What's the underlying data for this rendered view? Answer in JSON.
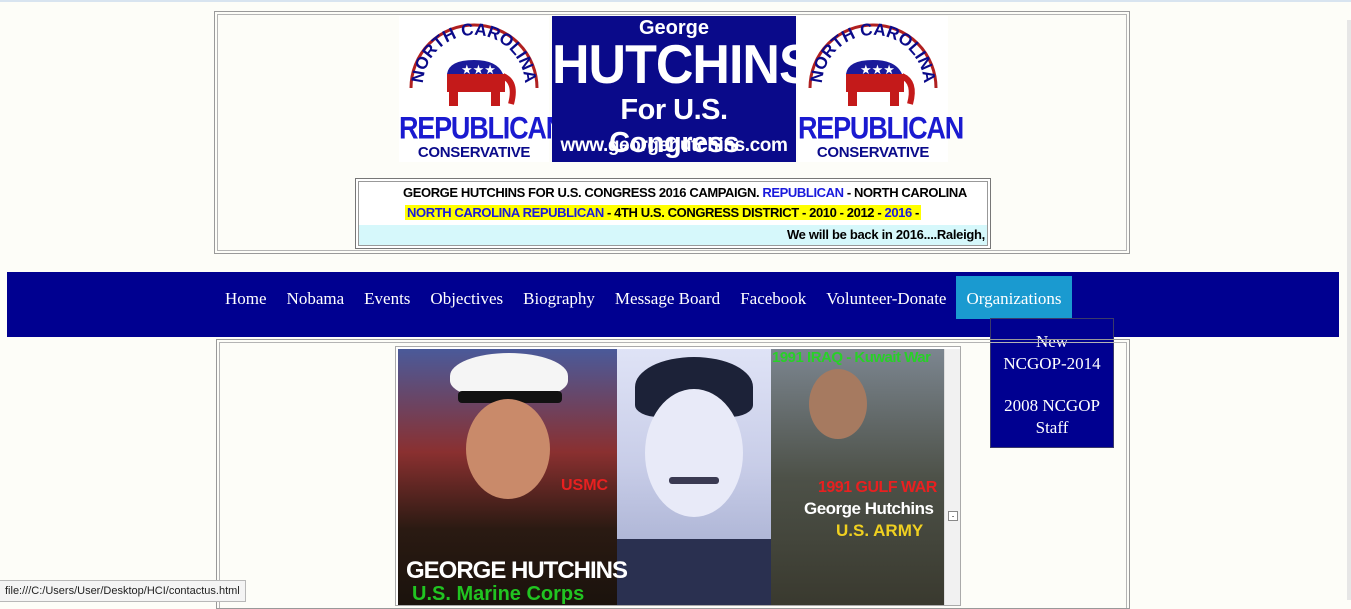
{
  "banner": {
    "state_text": "NORTH CAROLINA",
    "party": "REPUBLICAN",
    "ideology": "CONSERVATIVE",
    "candidate_first": "George",
    "candidate_last": "HUTCHINS",
    "office": "For U.S. Congress",
    "website": "www.georgehutchins.com"
  },
  "ticker": {
    "line1_a": "GEORGE HUTCHINS FOR U.S. CONGRESS 2016 CAMPAIGN. ",
    "line1_b": "REPUBLICAN",
    "line1_c": " - NORTH CAROLINA",
    "line2_a": "NORTH CAROLINA ",
    "line2_b": "REPUBLICAN",
    "line2_c": "  -  4TH U.S. CONGRESS DISTRICT  -  2010  -  2012  -  ",
    "line2_d": "2016",
    "line2_e": " -",
    "line3": "We will be back in 2016....Raleigh,"
  },
  "nav": {
    "items": [
      "Home",
      "Nobama",
      "Events",
      "Objectives",
      "Biography",
      "Message Board",
      "Facebook",
      "Volunteer-Donate",
      "Organizations"
    ],
    "active": "Organizations"
  },
  "dropdown": {
    "item1_line1": "New",
    "item1_line2": "NCGOP-2014",
    "item2_line1": "2008 NCGOP",
    "item2_line2": "Staff"
  },
  "photo": {
    "usmc": "USMC",
    "name_left": "GEORGE HUTCHINS",
    "branch_left": "U.S. Marine Corps",
    "war_header": "1991 IRAQ - Kuwait War",
    "gulf_war": "1991 GULF WAR",
    "name_right": "George Hutchins",
    "branch_right": "U.S. ARMY"
  },
  "status_bar": "file:///C:/Users/User/Desktop/HCI/contactus.html",
  "colors": {
    "nav_bg": "#000090",
    "nav_active": "#1a9ad0",
    "banner_blue": "#0a0a8a",
    "highlight": "#ffff00"
  }
}
